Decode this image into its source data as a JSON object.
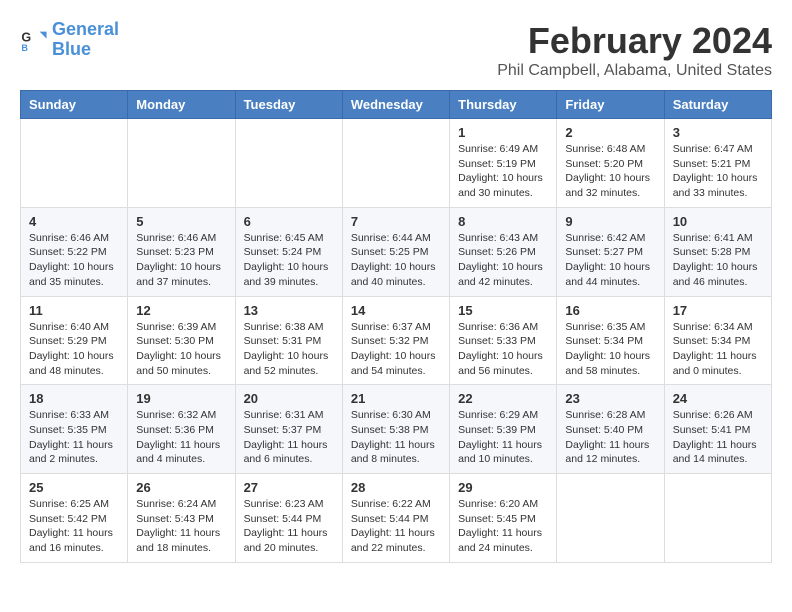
{
  "header": {
    "logo_line1": "General",
    "logo_line2": "Blue",
    "month_year": "February 2024",
    "location": "Phil Campbell, Alabama, United States"
  },
  "days_of_week": [
    "Sunday",
    "Monday",
    "Tuesday",
    "Wednesday",
    "Thursday",
    "Friday",
    "Saturday"
  ],
  "weeks": [
    [
      {
        "day": "",
        "info": ""
      },
      {
        "day": "",
        "info": ""
      },
      {
        "day": "",
        "info": ""
      },
      {
        "day": "",
        "info": ""
      },
      {
        "day": "1",
        "info": "Sunrise: 6:49 AM\nSunset: 5:19 PM\nDaylight: 10 hours\nand 30 minutes."
      },
      {
        "day": "2",
        "info": "Sunrise: 6:48 AM\nSunset: 5:20 PM\nDaylight: 10 hours\nand 32 minutes."
      },
      {
        "day": "3",
        "info": "Sunrise: 6:47 AM\nSunset: 5:21 PM\nDaylight: 10 hours\nand 33 minutes."
      }
    ],
    [
      {
        "day": "4",
        "info": "Sunrise: 6:46 AM\nSunset: 5:22 PM\nDaylight: 10 hours\nand 35 minutes."
      },
      {
        "day": "5",
        "info": "Sunrise: 6:46 AM\nSunset: 5:23 PM\nDaylight: 10 hours\nand 37 minutes."
      },
      {
        "day": "6",
        "info": "Sunrise: 6:45 AM\nSunset: 5:24 PM\nDaylight: 10 hours\nand 39 minutes."
      },
      {
        "day": "7",
        "info": "Sunrise: 6:44 AM\nSunset: 5:25 PM\nDaylight: 10 hours\nand 40 minutes."
      },
      {
        "day": "8",
        "info": "Sunrise: 6:43 AM\nSunset: 5:26 PM\nDaylight: 10 hours\nand 42 minutes."
      },
      {
        "day": "9",
        "info": "Sunrise: 6:42 AM\nSunset: 5:27 PM\nDaylight: 10 hours\nand 44 minutes."
      },
      {
        "day": "10",
        "info": "Sunrise: 6:41 AM\nSunset: 5:28 PM\nDaylight: 10 hours\nand 46 minutes."
      }
    ],
    [
      {
        "day": "11",
        "info": "Sunrise: 6:40 AM\nSunset: 5:29 PM\nDaylight: 10 hours\nand 48 minutes."
      },
      {
        "day": "12",
        "info": "Sunrise: 6:39 AM\nSunset: 5:30 PM\nDaylight: 10 hours\nand 50 minutes."
      },
      {
        "day": "13",
        "info": "Sunrise: 6:38 AM\nSunset: 5:31 PM\nDaylight: 10 hours\nand 52 minutes."
      },
      {
        "day": "14",
        "info": "Sunrise: 6:37 AM\nSunset: 5:32 PM\nDaylight: 10 hours\nand 54 minutes."
      },
      {
        "day": "15",
        "info": "Sunrise: 6:36 AM\nSunset: 5:33 PM\nDaylight: 10 hours\nand 56 minutes."
      },
      {
        "day": "16",
        "info": "Sunrise: 6:35 AM\nSunset: 5:34 PM\nDaylight: 10 hours\nand 58 minutes."
      },
      {
        "day": "17",
        "info": "Sunrise: 6:34 AM\nSunset: 5:34 PM\nDaylight: 11 hours\nand 0 minutes."
      }
    ],
    [
      {
        "day": "18",
        "info": "Sunrise: 6:33 AM\nSunset: 5:35 PM\nDaylight: 11 hours\nand 2 minutes."
      },
      {
        "day": "19",
        "info": "Sunrise: 6:32 AM\nSunset: 5:36 PM\nDaylight: 11 hours\nand 4 minutes."
      },
      {
        "day": "20",
        "info": "Sunrise: 6:31 AM\nSunset: 5:37 PM\nDaylight: 11 hours\nand 6 minutes."
      },
      {
        "day": "21",
        "info": "Sunrise: 6:30 AM\nSunset: 5:38 PM\nDaylight: 11 hours\nand 8 minutes."
      },
      {
        "day": "22",
        "info": "Sunrise: 6:29 AM\nSunset: 5:39 PM\nDaylight: 11 hours\nand 10 minutes."
      },
      {
        "day": "23",
        "info": "Sunrise: 6:28 AM\nSunset: 5:40 PM\nDaylight: 11 hours\nand 12 minutes."
      },
      {
        "day": "24",
        "info": "Sunrise: 6:26 AM\nSunset: 5:41 PM\nDaylight: 11 hours\nand 14 minutes."
      }
    ],
    [
      {
        "day": "25",
        "info": "Sunrise: 6:25 AM\nSunset: 5:42 PM\nDaylight: 11 hours\nand 16 minutes."
      },
      {
        "day": "26",
        "info": "Sunrise: 6:24 AM\nSunset: 5:43 PM\nDaylight: 11 hours\nand 18 minutes."
      },
      {
        "day": "27",
        "info": "Sunrise: 6:23 AM\nSunset: 5:44 PM\nDaylight: 11 hours\nand 20 minutes."
      },
      {
        "day": "28",
        "info": "Sunrise: 6:22 AM\nSunset: 5:44 PM\nDaylight: 11 hours\nand 22 minutes."
      },
      {
        "day": "29",
        "info": "Sunrise: 6:20 AM\nSunset: 5:45 PM\nDaylight: 11 hours\nand 24 minutes."
      },
      {
        "day": "",
        "info": ""
      },
      {
        "day": "",
        "info": ""
      }
    ]
  ]
}
